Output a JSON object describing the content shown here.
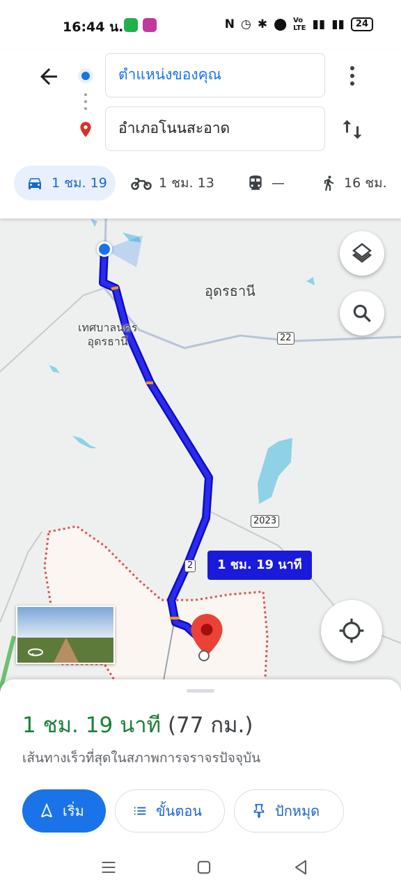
{
  "status_bar": {
    "time": "16:44 น.",
    "battery": "24",
    "icons": [
      "nfc-icon",
      "alarm-icon",
      "bluetooth-icon",
      "location-icon",
      "volte-icon",
      "signal-icon",
      "4g-signal-icon",
      "battery-icon"
    ]
  },
  "directions": {
    "origin": "ตำแหน่งของคุณ",
    "destination": "อำเภอโนนสะอาด",
    "modes": [
      {
        "icon": "car-icon",
        "label": "1 ชม. 19",
        "active": true
      },
      {
        "icon": "motorcycle-icon",
        "label": "1 ชม. 13",
        "active": false
      },
      {
        "icon": "transit-icon",
        "label": "—",
        "active": false
      },
      {
        "icon": "walk-icon",
        "label": "16 ชม.",
        "active": false
      }
    ]
  },
  "map": {
    "labels": {
      "city": "อุดรธานี",
      "municipality": "เทศบาลนคร\nอุดรธานี"
    },
    "route_shields": [
      "22",
      "2023",
      "2"
    ],
    "route_duration_chip": "1 ชม. 19 นาที"
  },
  "summary": {
    "duration": "1 ชม. 19 นาที",
    "distance": "(77 กม.)",
    "description": "เส้นทางเร็วที่สุดในสภาพการจราจรปัจจุบัน",
    "buttons": {
      "start": "เริ่ม",
      "steps": "ขั้นตอน",
      "pin": "ปักหมุด"
    }
  },
  "colors": {
    "accent": "#1a73e8",
    "route": "#1a1adb",
    "eta_green": "#188038",
    "destination_pin": "#ea4335"
  }
}
